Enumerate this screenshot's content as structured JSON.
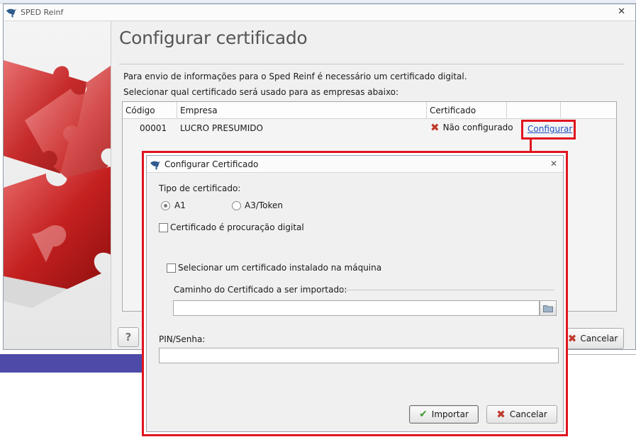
{
  "main_window": {
    "title": "SPED Reinf",
    "close_glyph": "✕",
    "heading": "Configurar certificado",
    "intro_line1": "Para envio de informações para o Sped Reinf é necessário um certificado digital.",
    "intro_line2": "Selecionar qual certificado será usado para as empresas abaixo:",
    "grid": {
      "columns": [
        "Código",
        "Empresa",
        "Certificado",
        "",
        ""
      ],
      "rows": [
        {
          "codigo": "00001",
          "empresa": "LUCRO PRESUMIDO",
          "certificado": "Não configurado",
          "action": "Configurar"
        }
      ]
    },
    "help_label": "?",
    "cancel_label": "Cancelar"
  },
  "dialog": {
    "title": "Configurar Certificado",
    "close_glyph": "✕",
    "cert_type_label": "Tipo de certificado:",
    "option_a1": "A1",
    "option_a3": "A3/Token",
    "selected_type": "A1",
    "procuracao_label": "Certificado é procuração digital",
    "procuracao_checked": false,
    "installed_label": "Selecionar um certificado instalado na máquina",
    "installed_checked": false,
    "path_label": "Caminho do Certificado a ser importado:",
    "path_value": "",
    "pin_label": "PIN/Senha:",
    "pin_value": "",
    "import_label": "Importar",
    "cancel_label": "Cancelar"
  },
  "colors": {
    "highlight": "#e0141e",
    "link": "#1f4fbf",
    "error_icon": "#c0392b",
    "ok_icon": "#3a9b2c",
    "taskbar": "#4d4aa8"
  },
  "icons": {
    "app": "bird-logo-icon",
    "status_error": "x-icon",
    "browse": "folder-icon",
    "confirm": "check-icon"
  }
}
